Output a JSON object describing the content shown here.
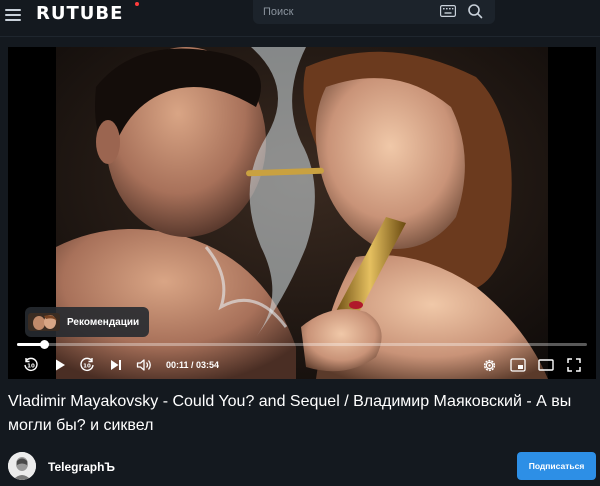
{
  "header": {
    "logo_text": "RUTUBE",
    "search_placeholder": "Поиск",
    "icons": [
      "menu-icon",
      "keyboard-icon",
      "search-icon"
    ]
  },
  "player": {
    "recommendations_label": "Рекомендации",
    "current_time": "00:11",
    "duration": "03:54",
    "time_display": "00:11 / 03:54",
    "progress_fraction": 0.047,
    "controls": [
      "rewind-10-icon",
      "play-icon",
      "forward-10-icon",
      "next-icon",
      "volume-icon",
      "settings-icon",
      "pip-icon",
      "theater-mode-icon",
      "fullscreen-icon"
    ]
  },
  "video": {
    "title": "Vladimir Mayakovsky - Could You? and Sequel / Владимир Маяковский - А вы могли бы? и сиквел"
  },
  "channel": {
    "name": "TelegraphЪ",
    "subscribe_label": "Подписаться"
  },
  "colors": {
    "background": "#14191f",
    "subscribe": "#2d8fe6",
    "logo_dot": "#ff3c3c"
  }
}
